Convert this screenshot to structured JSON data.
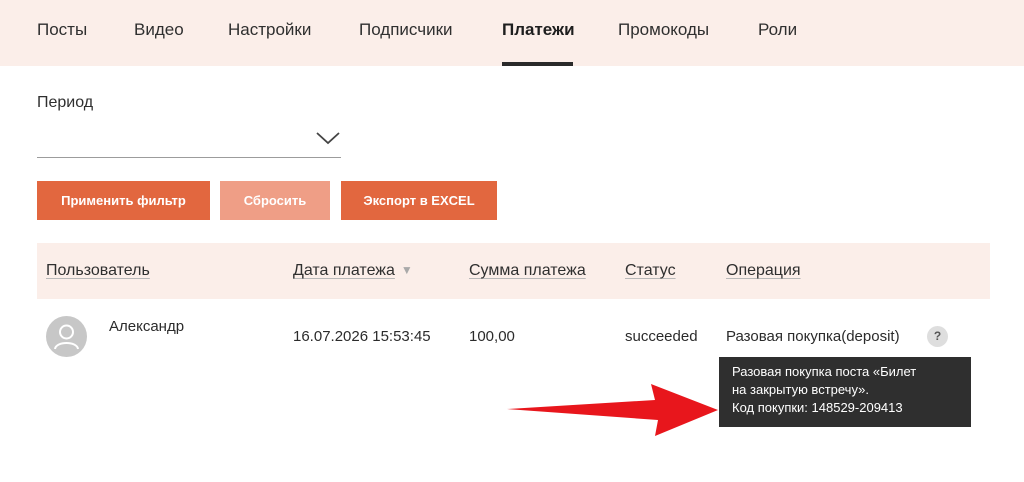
{
  "nav": {
    "tabs": [
      {
        "label": "Посты"
      },
      {
        "label": "Видео"
      },
      {
        "label": "Настройки"
      },
      {
        "label": "Подписчики"
      },
      {
        "label": "Платежи",
        "active": true
      },
      {
        "label": "Промокоды"
      },
      {
        "label": "Роли"
      }
    ]
  },
  "filter": {
    "period_label": "Период",
    "period_value": "",
    "apply_label": "Применить фильтр",
    "reset_label": "Сбросить",
    "export_label": "Экспорт в EXCEL"
  },
  "table": {
    "headers": [
      "Пользователь",
      "Дата платежа",
      "Сумма платежа",
      "Статус",
      "Операция"
    ],
    "sort_indicator": "▼",
    "rows": [
      {
        "user": "Александр",
        "date": "16.07.2026 15:53:45",
        "amount": "100,00",
        "status": "succeeded",
        "operation": "Разовая покупка(deposit)",
        "help": "?"
      }
    ]
  },
  "tooltip": {
    "line1": "Разовая покупка поста «Билет",
    "line2": "на закрытую встречу».",
    "line3": "Код покупки: 148529-209413"
  },
  "colors": {
    "accent": "#e2673f",
    "accent_light": "#ef9e86",
    "header_bg": "#fbeee9",
    "tooltip_bg": "#2f2f2f",
    "arrow": "#e8161c"
  }
}
